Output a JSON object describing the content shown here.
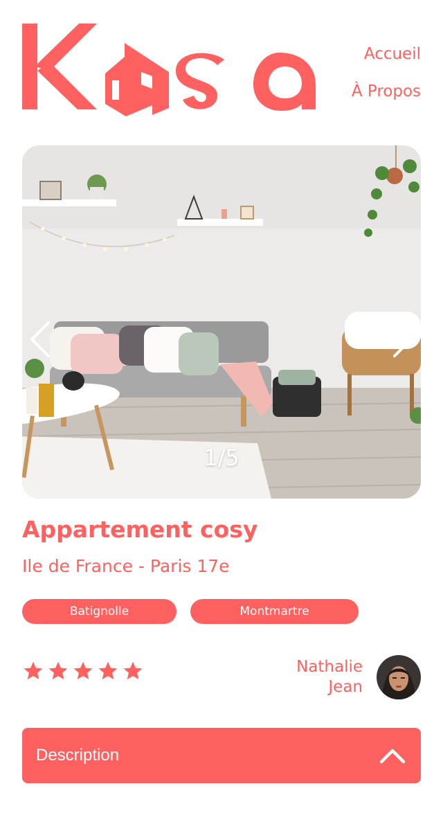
{
  "brand": {
    "logo_text": "Kasa",
    "accent_color": "#FF6060"
  },
  "nav": {
    "home": "Accueil",
    "about": "À Propos"
  },
  "gallery": {
    "counter": "1/5",
    "current_index": 1,
    "total": 5,
    "image_subject": "cosy living room with grey sofa, cushions, shelves, plant and rattan chair",
    "prev_icon": "chevron-left-icon",
    "next_icon": "chevron-right-icon"
  },
  "listing": {
    "title": "Appartement cosy",
    "location": "Ile de France - Paris 17e",
    "tags": [
      "Batignolle",
      "Montmartre"
    ],
    "rating": 5,
    "rating_max": 5
  },
  "host": {
    "first_name": "Nathalie",
    "last_name": "Jean"
  },
  "collapse": {
    "label": "Description",
    "icon": "chevron-up-icon"
  }
}
